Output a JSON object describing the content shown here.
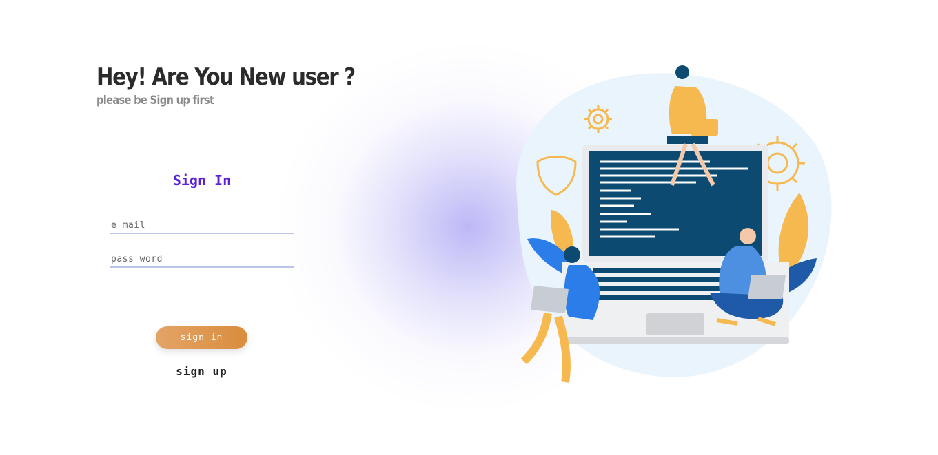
{
  "hero": {
    "headline": "Hey! Are You New user ?",
    "subline": "please be Sign up first"
  },
  "form": {
    "title": "Sign In",
    "email_placeholder": "e mail",
    "password_placeholder": "pass word",
    "signin_label": "sign in",
    "signup_label": "sign up"
  },
  "colors": {
    "title_accent": "#5a20d6",
    "button_start": "#e4a467",
    "button_end": "#d98d3c",
    "field_underline": "#b9c4e6",
    "glow": "#b2acf5"
  },
  "illustration": {
    "icon": "team-working-on-laptop-illustration"
  }
}
